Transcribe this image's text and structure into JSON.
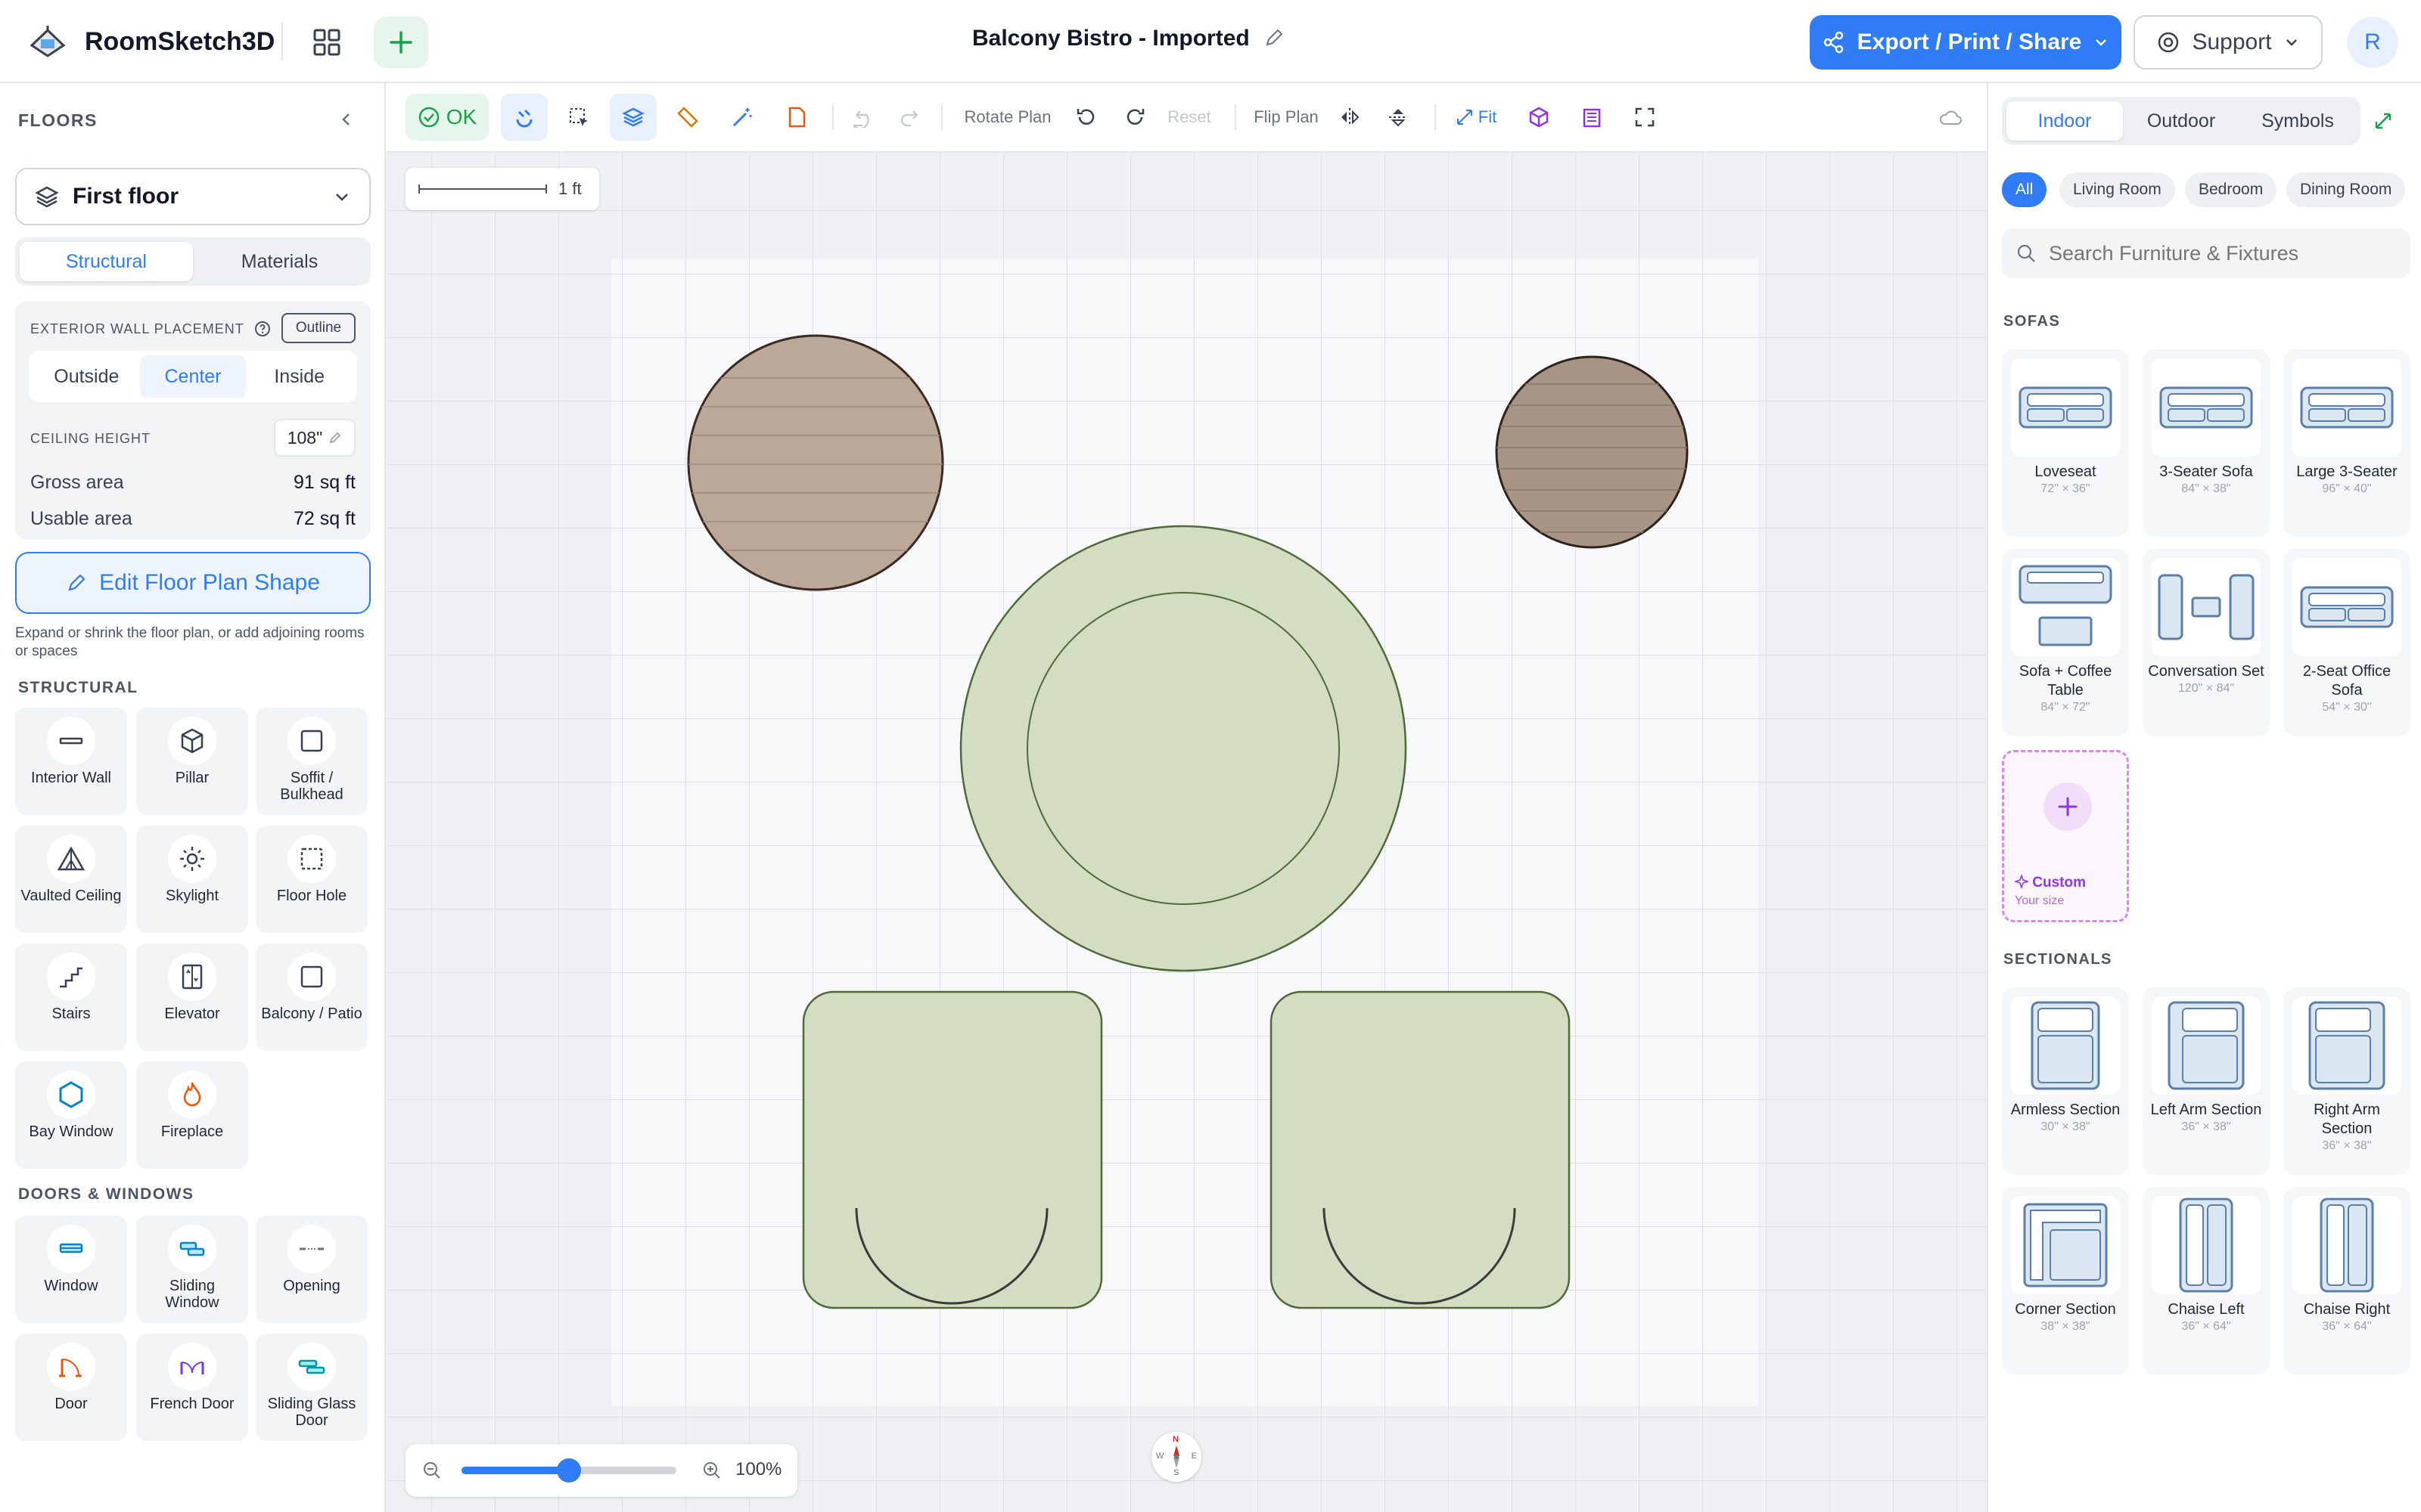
{
  "app": {
    "name": "RoomSketch3D",
    "doc_title": "Balcony Bistro - Imported"
  },
  "header": {
    "export_label": "Export / Print / Share",
    "support_label": "Support",
    "avatar_initial": "R"
  },
  "left": {
    "floors_title": "FLOORS",
    "floor_name": "First floor",
    "tabs": [
      "Structural",
      "Materials"
    ],
    "wall_placement_label": "EXTERIOR WALL PLACEMENT",
    "outline_label": "Outline",
    "placement_options": [
      "Outside",
      "Center",
      "Inside"
    ],
    "ceiling_label": "CEILING HEIGHT",
    "ceiling_value": "108\"",
    "gross_label": "Gross area",
    "gross_value": "91 sq ft",
    "usable_label": "Usable area",
    "usable_value": "72 sq ft",
    "edit_shape_label": "Edit Floor Plan Shape",
    "edit_hint": "Expand or shrink the floor plan, or add adjoining rooms or spaces",
    "structural_title": "STRUCTURAL",
    "structural_items": [
      {
        "label": "Interior Wall",
        "icon": "wall-icon"
      },
      {
        "label": "Pillar",
        "icon": "cube-icon"
      },
      {
        "label": "Soffit / Bulkhead",
        "icon": "soffit-icon"
      },
      {
        "label": "Vaulted Ceiling",
        "icon": "tent-icon"
      },
      {
        "label": "Skylight",
        "icon": "sun-icon"
      },
      {
        "label": "Floor Hole",
        "icon": "dashed-square-icon"
      },
      {
        "label": "Stairs",
        "icon": "stairs-icon"
      },
      {
        "label": "Elevator",
        "icon": "elevator-icon"
      },
      {
        "label": "Balcony / Patio",
        "icon": "balcony-icon"
      },
      {
        "label": "Bay Window",
        "icon": "hexagon-icon"
      },
      {
        "label": "Fireplace",
        "icon": "flame-icon"
      }
    ],
    "doors_title": "DOORS & WINDOWS",
    "door_items": [
      {
        "label": "Window",
        "icon": "window-icon"
      },
      {
        "label": "Sliding Window",
        "icon": "sliding-window-icon"
      },
      {
        "label": "Opening",
        "icon": "opening-icon"
      },
      {
        "label": "Door",
        "icon": "door-icon"
      },
      {
        "label": "French Door",
        "icon": "french-door-icon"
      },
      {
        "label": "Sliding Glass Door",
        "icon": "sliding-door-icon"
      }
    ]
  },
  "toolbar": {
    "ok_label": "OK",
    "rotate_plan_label": "Rotate Plan",
    "reset_label": "Reset",
    "flip_plan_label": "Flip Plan",
    "fit_label": "Fit",
    "scale_label": "1 ft",
    "zoom_label": "100%",
    "zoom_level": 0.5
  },
  "right": {
    "tabs": [
      "Indoor",
      "Outdoor",
      "Symbols"
    ],
    "chips": [
      "All",
      "Living Room",
      "Bedroom",
      "Dining Room"
    ],
    "search_placeholder": "Search Furniture & Fixtures",
    "sofas_title": "SOFAS",
    "sofas": [
      {
        "name": "Loveseat",
        "dims": "72\" × 36\""
      },
      {
        "name": "3-Seater Sofa",
        "dims": "84\" × 38\""
      },
      {
        "name": "Large 3-Seater",
        "dims": "96\" × 40\""
      },
      {
        "name": "Sofa + Coffee Table",
        "dims": "84\" × 72\""
      },
      {
        "name": "Conversation Set",
        "dims": "120\" × 84\""
      },
      {
        "name": "2-Seat Office Sofa",
        "dims": "54\" × 30\""
      }
    ],
    "custom_label": "Custom",
    "custom_sub": "Your size",
    "sectionals_title": "SECTIONALS",
    "sectionals": [
      {
        "name": "Armless Section",
        "dims": "30\" × 38\""
      },
      {
        "name": "Left Arm Section",
        "dims": "36\" × 38\""
      },
      {
        "name": "Right Arm Section",
        "dims": "36\" × 38\""
      },
      {
        "name": "Corner Section",
        "dims": "38\" × 38\""
      },
      {
        "name": "Chaise Left",
        "dims": "36\" × 64\""
      },
      {
        "name": "Chaise Right",
        "dims": "36\" × 64\""
      }
    ]
  },
  "compass": {
    "n": "N",
    "s": "S",
    "e": "E",
    "w": "W"
  },
  "colors": {
    "accent": "#2f7cf6",
    "chair_fill": "#d3ddc2",
    "wood_fill": "#bca898",
    "ok_green": "#16a34a"
  }
}
